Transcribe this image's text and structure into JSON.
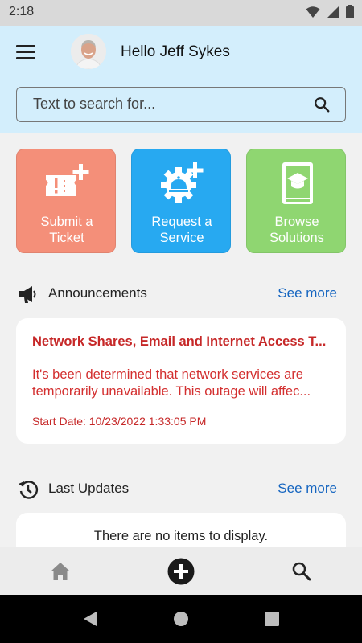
{
  "status_bar": {
    "time": "2:18"
  },
  "header": {
    "greeting": "Hello Jeff Sykes",
    "search": {
      "placeholder": "Text to search for...",
      "value": ""
    }
  },
  "tiles": [
    {
      "label_line1": "Submit a",
      "label_line2": "Ticket",
      "color": "#f48f79",
      "icon": "ticket-add-icon"
    },
    {
      "label_line1": "Request a",
      "label_line2": "Service",
      "color": "#27a9f1",
      "icon": "service-gear-add-icon"
    },
    {
      "label_line1": "Browse",
      "label_line2": "Solutions",
      "color": "#8fd671",
      "icon": "book-cap-icon"
    }
  ],
  "announcements": {
    "title": "Announcements",
    "see_more": "See more",
    "items": [
      {
        "title": "Network Shares, Email and Internet Access T...",
        "body_line1": "It's been determined that network services are",
        "body_line2": "temporarily unavailable. This outage will affec...",
        "start_date": "Start Date: 10/23/2022 1:33:05 PM"
      }
    ]
  },
  "last_updates": {
    "title": "Last Updates",
    "see_more": "See more",
    "empty_message": "There are no items to display."
  },
  "bottom_nav": [
    "home-icon",
    "add-circle-icon",
    "search-icon"
  ],
  "colors": {
    "accent": "#1565c0",
    "alert": "#c62828",
    "header_bg": "#d3eefc"
  }
}
